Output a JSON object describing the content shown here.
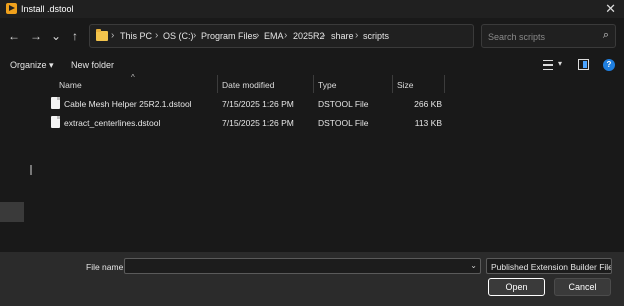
{
  "window": {
    "title": "Install .dstool"
  },
  "nav": {
    "back": "←",
    "forward": "→",
    "recent": "⌄",
    "up": "↑",
    "breadcrumbs": [
      "This PC",
      "OS (C:)",
      "Program Files",
      "EMA",
      "2025R2",
      "share",
      "scripts"
    ],
    "search_placeholder": "Search scripts"
  },
  "toolbar": {
    "organize_label": "Organize",
    "new_folder_label": "New folder"
  },
  "columns": {
    "name": "Name",
    "date_modified": "Date modified",
    "type": "Type",
    "size": "Size"
  },
  "files": [
    {
      "name": "Cable Mesh Helper 25R2.1.dstool",
      "date_modified": "7/15/2025 1:26 PM",
      "type": "DSTOOL File",
      "size": "266 KB"
    },
    {
      "name": "extract_centerlines.dstool",
      "date_modified": "7/15/2025 1:26 PM",
      "type": "DSTOOL File",
      "size": "113 KB"
    }
  ],
  "footer": {
    "file_name_label": "File name:",
    "file_name_value": "",
    "file_type": "Published Extension Builder File",
    "open_label": "Open",
    "cancel_label": "Cancel"
  },
  "icons": {
    "app": "play-icon",
    "folder": "folder-icon",
    "search": "search-icon",
    "refresh": "refresh-icon",
    "view": "view-menu-icon",
    "preview": "preview-pane-icon",
    "help": "help-icon"
  },
  "colors": {
    "background": "#191919",
    "footer": "#2b2b2b",
    "accent": "#1f7fe0",
    "app_icon": "#f0a11c"
  }
}
